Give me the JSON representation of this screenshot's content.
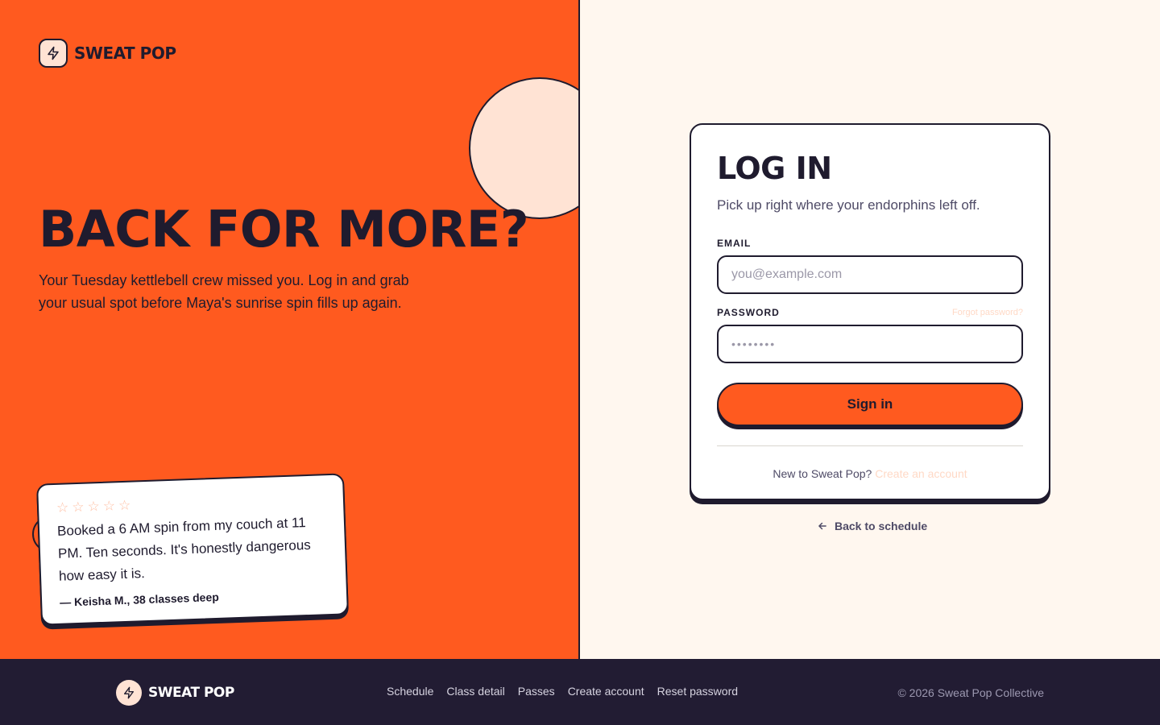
{
  "brand": {
    "name": "SWEAT POP",
    "icon": "bolt-icon"
  },
  "hero": {
    "title": "BACK FOR MORE?",
    "subtitle": "Your Tuesday kettlebell crew missed you. Log in and grab your usual spot before Maya's sunrise spin fills up again."
  },
  "review": {
    "rating": 0,
    "max_rating": 5,
    "quote": "Booked a 6 AM spin from my couch at 11 PM. Ten seconds. It's honestly dangerous how easy it is.",
    "author": "— Keisha M., 38 classes deep"
  },
  "login": {
    "title": "LOG IN",
    "subtitle": "Pick up right where your endorphins left off.",
    "email_label": "EMAIL",
    "email_placeholder": "you@example.com",
    "password_label": "PASSWORD",
    "forgot_password": "Forgot password?",
    "password_placeholder": "••••••••",
    "submit": "Sign in",
    "signup_prompt": "New to Sweat Pop?",
    "signup_link": "Create an account"
  },
  "back_link": {
    "label": "Back to schedule",
    "icon": "arrow-left-icon"
  },
  "footer": {
    "brand": "SWEAT POP",
    "nav": [
      "Schedule",
      "Class detail",
      "Passes",
      "Create account",
      "Reset password"
    ],
    "copyright": "© 2026 Sweat Pop Collective"
  },
  "colors": {
    "primary": "#ff5a1f",
    "ink": "#1f1b2e",
    "cream": "#fff7ef",
    "peach": "#ffe3d4",
    "footer_bg": "#221c33"
  }
}
